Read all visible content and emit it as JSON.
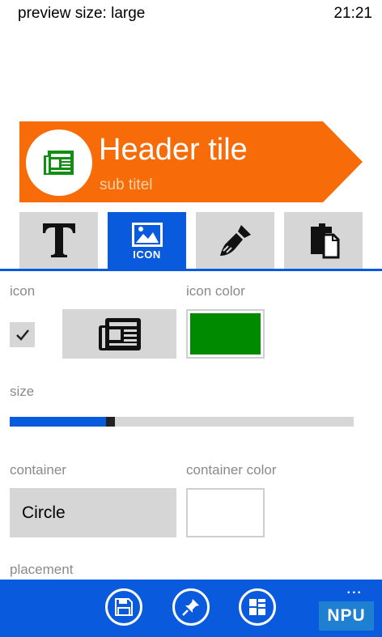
{
  "status_bar": {
    "title": "preview size: large",
    "time": "21:21"
  },
  "tile": {
    "title": "Header tile",
    "subtitle": "sub titel",
    "tile_color": "#f76b08",
    "icon_color": "#109010",
    "icon": "newspaper-icon"
  },
  "tabs": [
    {
      "name": "text",
      "label": "",
      "icon": "text-T-icon",
      "active": false
    },
    {
      "name": "icon",
      "label": "ICON",
      "icon": "image-icon",
      "active": true
    },
    {
      "name": "style",
      "label": "",
      "icon": "paintbrush-icon",
      "active": false
    },
    {
      "name": "paste",
      "label": "",
      "icon": "clipboard-icon",
      "active": false
    }
  ],
  "form": {
    "icon_label": "icon",
    "icon_color_label": "icon color",
    "icon_enabled": true,
    "selected_icon": "newspaper-icon",
    "icon_color_value": "#008a00",
    "size_label": "size",
    "size_value_percent": 28,
    "container_label": "container",
    "container_value": "Circle",
    "container_color_label": "container color",
    "container_color_value": "#ffffff",
    "placement_label": "placement"
  },
  "app_bar": {
    "buttons": [
      "save-icon",
      "pin-icon",
      "tiles-icon"
    ],
    "more": "..."
  },
  "watermark": "NPU",
  "accent_color": "#0a5ade"
}
